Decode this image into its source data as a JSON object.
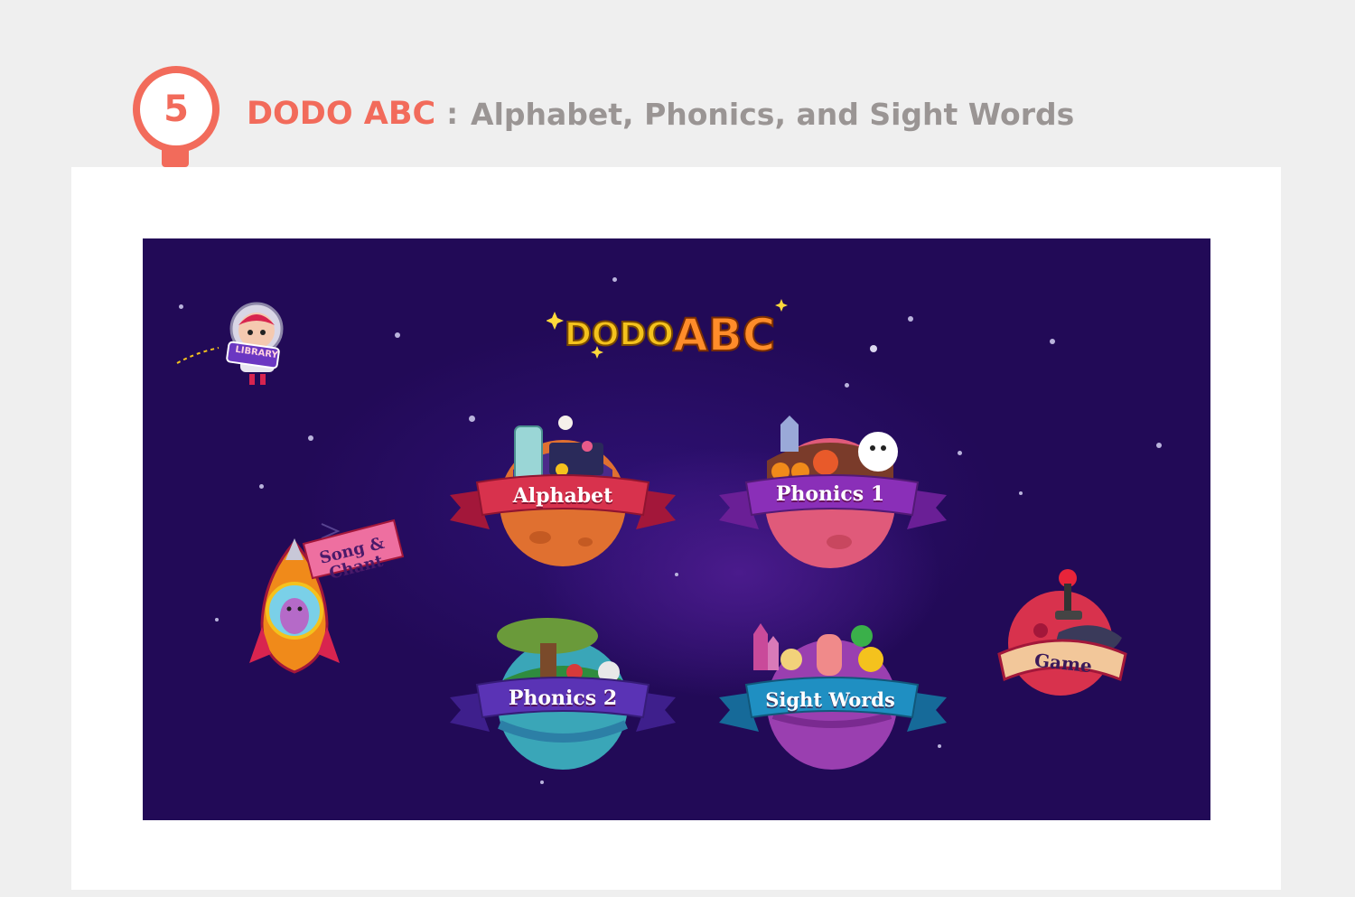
{
  "header": {
    "step_number": "5",
    "brand": "DODO ABC",
    "separator": ":",
    "subtitle": "Alphabet, Phonics, and Sight Words",
    "accent_color": "#f26b5b",
    "text_color": "#9a9594"
  },
  "app": {
    "background_color": "#220a57",
    "logo": {
      "word1": "DODO",
      "word2": "ABC"
    },
    "library": {
      "label": "LIBRARY",
      "icon": "astronaut-icon"
    },
    "menu": [
      {
        "key": "alphabet",
        "label": "Alphabet",
        "ribbon_color": "#d8324d",
        "icon": "alphabet-planet-icon"
      },
      {
        "key": "phonics1",
        "label": "Phonics 1",
        "ribbon_color": "#8a2fb8",
        "icon": "phonics1-planet-icon"
      },
      {
        "key": "phonics2",
        "label": "Phonics 2",
        "ribbon_color": "#5a33b5",
        "icon": "phonics2-planet-icon"
      },
      {
        "key": "sightwords",
        "label": "Sight Words",
        "ribbon_color": "#1f8fc2",
        "icon": "sightwords-planet-icon"
      }
    ],
    "song_chant": {
      "line1": "Song &",
      "line2": "Chant",
      "icon": "rocket-icon"
    },
    "game": {
      "label": "Game",
      "icon": "joystick-planet-icon"
    }
  }
}
